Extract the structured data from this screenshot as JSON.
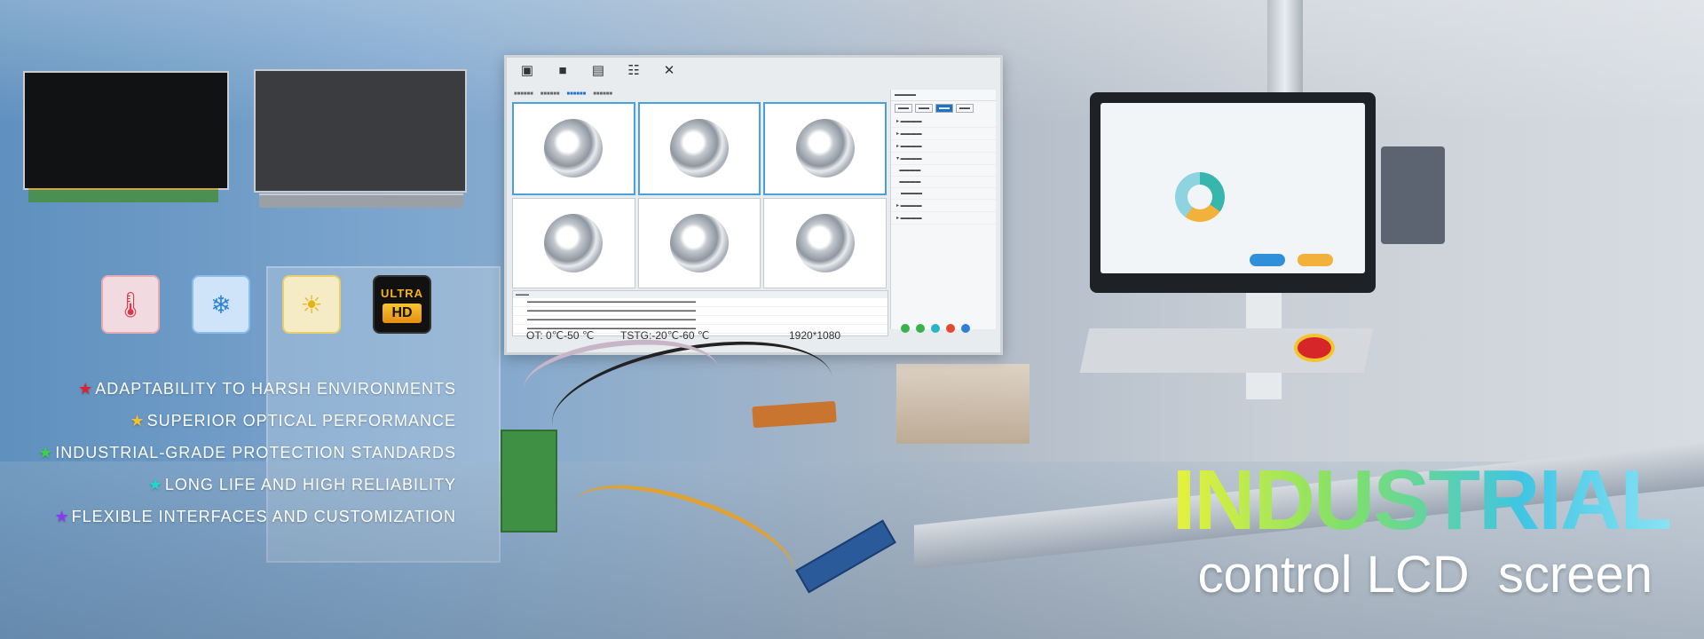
{
  "features": [
    {
      "star_color": "#e21f2d",
      "text": "ADAPTABILITY TO HARSH ENVIRONMENTS"
    },
    {
      "star_color": "#f2c12e",
      "text": "SUPERIOR OPTICAL PERFORMANCE"
    },
    {
      "star_color": "#39d14a",
      "text": "INDUSTRIAL-GRADE PROTECTION STANDARDS"
    },
    {
      "star_color": "#23d6c6",
      "text": "LONG LIFE AND HIGH RELIABILITY"
    },
    {
      "star_color": "#8b39f0",
      "text": "FLEXIBLE INTERFACES AND CUSTOMIZATION"
    }
  ],
  "badges": {
    "temperature_icon": "thermometer-icon",
    "cold_icon": "snowflake-thermometer-icon",
    "sun_icon": "sun-icon",
    "uhd_top": "ULTRA",
    "uhd_bottom": "HD"
  },
  "lcd": {
    "ot": "OT: 0℃-50 ℃",
    "tstg": "TSTG:-20℃-60 ℃",
    "resolution": "1920*1080"
  },
  "title": {
    "line1": "INDUSTRIAL",
    "line2": "control LCD  screen"
  },
  "colors": {
    "title_gradient_start": "#e8f23a",
    "title_gradient_end": "#89e3f4",
    "accent_blue": "#1e73c4"
  }
}
